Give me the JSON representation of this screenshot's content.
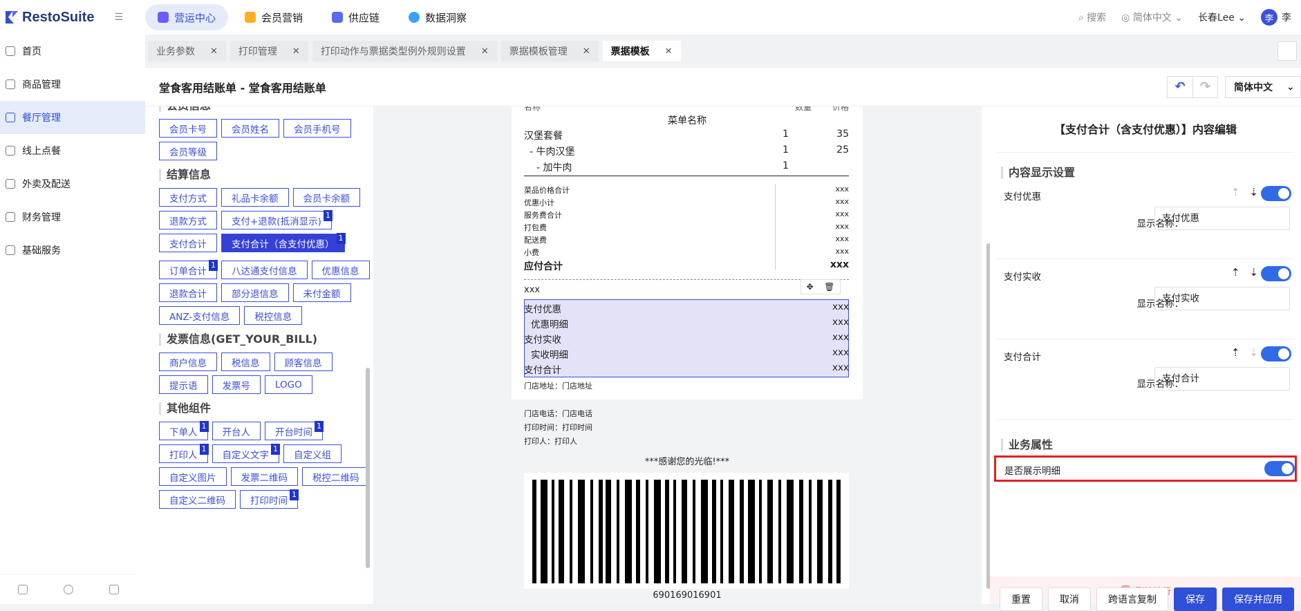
{
  "brand": {
    "name": "RestoSuite"
  },
  "topnav": [
    {
      "label": "营运中心",
      "color": "#6b5cff"
    },
    {
      "label": "会员营销",
      "color": "#ffb020"
    },
    {
      "label": "供应链",
      "color": "#5a6bf0"
    },
    {
      "label": "数据洞察",
      "color": "#3aa0ff"
    }
  ],
  "topright": {
    "search": "搜索",
    "lang": "简体中文",
    "user": "长春Lee",
    "avatar": "李",
    "avatar_name": "李"
  },
  "sidebar": [
    {
      "label": "首页"
    },
    {
      "label": "商品管理"
    },
    {
      "label": "餐厅管理"
    },
    {
      "label": "线上点餐"
    },
    {
      "label": "外卖及配送"
    },
    {
      "label": "财务管理"
    },
    {
      "label": "基础服务"
    }
  ],
  "tabs": [
    {
      "label": "业务参数"
    },
    {
      "label": "打印管理"
    },
    {
      "label": "打印动作与票据类型例外规则设置"
    },
    {
      "label": "票据模板管理"
    },
    {
      "label": "票据模板"
    }
  ],
  "header": {
    "title": "堂食客用结账单 - 堂食客用结账单",
    "lang": "简体中文"
  },
  "components": {
    "partial_title": "会员信息",
    "member": [
      {
        "label": "会员卡号"
      },
      {
        "label": "会员姓名"
      },
      {
        "label": "会员手机号"
      },
      {
        "label": "会员等级"
      }
    ],
    "settle_title": "结算信息",
    "settle": [
      {
        "label": "支付方式"
      },
      {
        "label": "礼品卡余额"
      },
      {
        "label": "会员卡余额"
      },
      {
        "label": "退款方式"
      },
      {
        "label": "支付+退款(抵消显示)",
        "badge": "1"
      },
      {
        "label": "支付合计"
      },
      {
        "label": "支付合计（含支付优惠）",
        "badge": "1",
        "active": true
      },
      {
        "label": "订单合计",
        "badge": "1"
      },
      {
        "label": "八达通支付信息"
      },
      {
        "label": "优惠信息"
      },
      {
        "label": "退款合计"
      },
      {
        "label": "部分退信息"
      },
      {
        "label": "未付金额"
      },
      {
        "label": "ANZ-支付信息"
      },
      {
        "label": "税控信息"
      }
    ],
    "invoice_title": "发票信息(GET_YOUR_BILL)",
    "invoice": [
      {
        "label": "商户信息"
      },
      {
        "label": "税信息"
      },
      {
        "label": "顾客信息"
      },
      {
        "label": "提示语"
      },
      {
        "label": "发票号"
      },
      {
        "label": "LOGO"
      }
    ],
    "other_title": "其他组件",
    "other": [
      {
        "label": "下单人",
        "badge": "1"
      },
      {
        "label": "开台人"
      },
      {
        "label": "开台时间",
        "badge": "1"
      },
      {
        "label": "打印人",
        "badge": "1"
      },
      {
        "label": "自定义文字",
        "badge": "1"
      },
      {
        "label": "自定义组"
      },
      {
        "label": "自定义图片"
      },
      {
        "label": "发票二维码"
      },
      {
        "label": "税控二维码"
      },
      {
        "label": "自定义二维码"
      },
      {
        "label": "打印时间",
        "badge": "1"
      }
    ]
  },
  "receipt": {
    "partial_head": [
      "名称",
      "数量",
      "价格"
    ],
    "menu_header": "菜单名称",
    "items": [
      {
        "name": "汉堡套餐",
        "qty": "1",
        "price": "35"
      },
      {
        "name": "- 牛肉汉堡",
        "qty": "1",
        "price": "25"
      },
      {
        "name": "- 加牛肉",
        "qty": "1",
        "price": ""
      }
    ],
    "totals": [
      {
        "label": "菜品价格合计",
        "val": "xxx"
      },
      {
        "label": "优惠小计",
        "val": "xxx"
      },
      {
        "label": "服务费合计",
        "val": "xxx"
      },
      {
        "label": "打包费",
        "val": "xxx"
      },
      {
        "label": "配送费",
        "val": "xxx"
      },
      {
        "label": "小费",
        "val": "xxx"
      }
    ],
    "due": {
      "label": "应付合计",
      "val": "xxx"
    },
    "xxx_line": "xxx",
    "pay": [
      {
        "label": "支付优惠",
        "val": "xxx"
      },
      {
        "label": "优惠明细",
        "val": "xxx"
      },
      {
        "label": "支付实收",
        "val": "xxx"
      },
      {
        "label": "实收明细",
        "val": "xxx"
      },
      {
        "label": "支付合计",
        "val": "xxx"
      }
    ],
    "store": [
      "门店地址：门店地址",
      "门店电话：门店电话",
      "打印时间：打印时间",
      "打印人：打印人"
    ],
    "thanks": "***感谢您的光临!***",
    "barcode": "690169016901"
  },
  "props": {
    "title": "【支付合计（含支付优惠）】内容编辑",
    "display_title": "内容显示设置",
    "name_label": "显示名称：",
    "fields": [
      {
        "label": "支付优惠",
        "value": "支付优惠",
        "on": true
      },
      {
        "label": "支付实收",
        "value": "支付实收",
        "on": true
      },
      {
        "label": "支付合计",
        "value": "支付合计",
        "on": true
      }
    ],
    "biz_title": "业务属性",
    "biz": [
      {
        "label": "是否展示明细",
        "on": true
      }
    ],
    "delete": "删除该行",
    "buttons": [
      "重置",
      "取消",
      "跨语言复制",
      "保存",
      "保存并应用"
    ]
  }
}
